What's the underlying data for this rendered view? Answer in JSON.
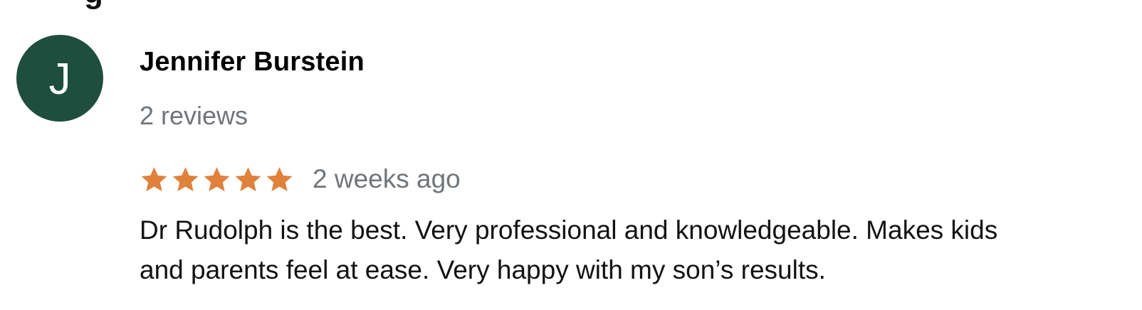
{
  "review": {
    "avatar_letter": "J",
    "avatar_color": "#1f4d3e",
    "reviewer_name": "Jennifer Burstein",
    "review_count": "2 reviews",
    "rating": 5,
    "rating_max": 5,
    "star_icon": "star-icon",
    "star_color": "#e0813c",
    "time_ago": "2 weeks ago",
    "text_line_1": "Dr Rudolph is the best. Very professional and knowledgeable. Makes kids",
    "text_line_2": "and parents feel at ease. Very happy with my son’s results."
  }
}
